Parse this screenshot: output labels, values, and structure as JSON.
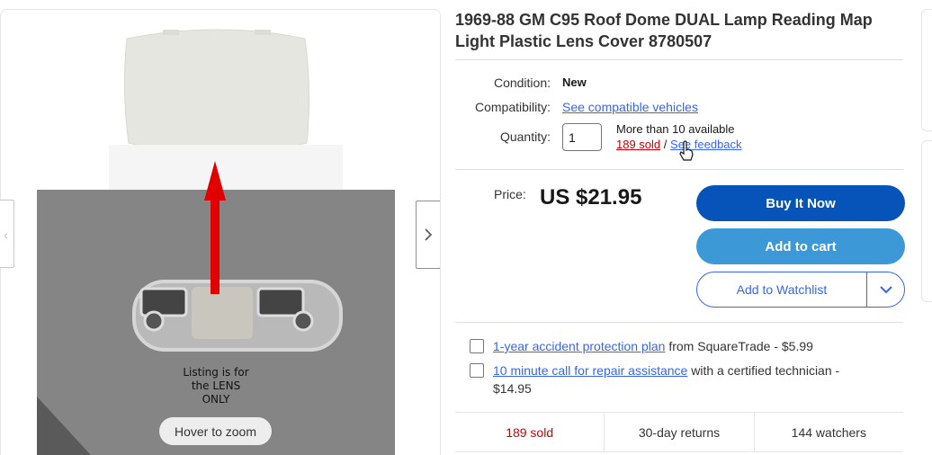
{
  "title": "1969-88 GM C95 Roof Dome DUAL Lamp Reading Map Light Plastic Lens Cover 8780507",
  "gallery": {
    "zoom_label": "Hover to zoom",
    "image_caption": "Listing is for\nthe LENS\nONLY"
  },
  "condition": {
    "label": "Condition:",
    "value": "New"
  },
  "compatibility": {
    "label": "Compatibility:",
    "link": "See compatible vehicles"
  },
  "quantity": {
    "label": "Quantity:",
    "value": "1",
    "available": "More than 10 available",
    "sold": "189 sold",
    "separator": "/",
    "feedback": "See feedback"
  },
  "price": {
    "label": "Price:",
    "value": "US $21.95"
  },
  "buttons": {
    "buy_now": "Buy It Now",
    "add_to_cart": "Add to cart",
    "watchlist": "Add to Watchlist"
  },
  "protection": [
    {
      "link": "1-year accident protection plan",
      "text": " from SquareTrade - $5.99"
    },
    {
      "link": "10 minute call for repair assistance",
      "text": " with a certified technician - $14.95"
    }
  ],
  "stats": {
    "sold": "189 sold",
    "returns": "30-day returns",
    "watchers": "144 watchers"
  },
  "colors": {
    "buy_now": "#0654ba",
    "add_to_cart": "#3d98d8",
    "link": "#3665f3",
    "sold": "#c90009"
  }
}
